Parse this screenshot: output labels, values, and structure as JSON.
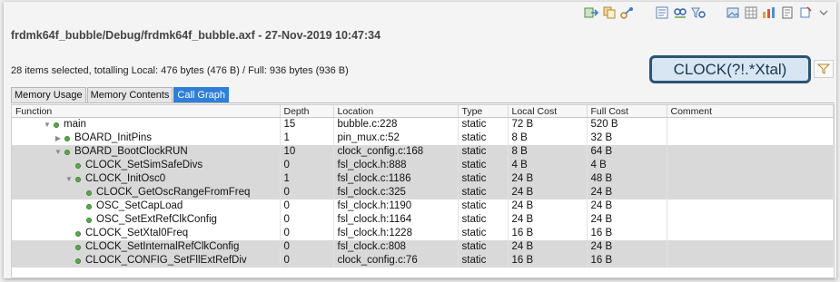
{
  "title": "frdmk64f_bubble/Debug/frdmk64f_bubble.axf - 27-Nov-2019 10:47:34",
  "summary": "28 items selected, totalling Local: 476 bytes (476 B) / Full: 936 bytes (936 B)",
  "filter": {
    "value": "CLOCK(?!.*Xtal)"
  },
  "tabs": [
    {
      "label": "Memory Usage",
      "active": false
    },
    {
      "label": "Memory Contents",
      "active": false
    },
    {
      "label": "Call Graph",
      "active": true
    }
  ],
  "columns": [
    "Function",
    "Depth",
    "Location",
    "Type",
    "Local Cost",
    "Full Cost",
    "Comment"
  ],
  "rows": [
    {
      "indent": 0,
      "twisty": "expanded",
      "name": "main",
      "depth": "15",
      "location": "bubble.c:228",
      "type": "static",
      "local": "72 B",
      "full": "520 B",
      "comment": "",
      "selected": false
    },
    {
      "indent": 1,
      "twisty": "collapsed",
      "name": "BOARD_InitPins",
      "depth": "1",
      "location": "pin_mux.c:52",
      "type": "static",
      "local": "8 B",
      "full": "32 B",
      "comment": "",
      "selected": false
    },
    {
      "indent": 1,
      "twisty": "expanded",
      "name": "BOARD_BootClockRUN",
      "depth": "10",
      "location": "clock_config.c:168",
      "type": "static",
      "local": "8 B",
      "full": "64 B",
      "comment": "",
      "selected": true
    },
    {
      "indent": 2,
      "twisty": "none",
      "name": "CLOCK_SetSimSafeDivs",
      "depth": "0",
      "location": "fsl_clock.h:888",
      "type": "static",
      "local": "4 B",
      "full": "4 B",
      "comment": "",
      "selected": true
    },
    {
      "indent": 2,
      "twisty": "expanded",
      "name": "CLOCK_InitOsc0",
      "depth": "1",
      "location": "fsl_clock.c:1186",
      "type": "static",
      "local": "24 B",
      "full": "48 B",
      "comment": "",
      "selected": true
    },
    {
      "indent": 3,
      "twisty": "none",
      "name": "CLOCK_GetOscRangeFromFreq",
      "depth": "0",
      "location": "fsl_clock.c:325",
      "type": "static",
      "local": "24 B",
      "full": "24 B",
      "comment": "",
      "selected": true
    },
    {
      "indent": 3,
      "twisty": "none",
      "name": "OSC_SetCapLoad",
      "depth": "0",
      "location": "fsl_clock.h:1190",
      "type": "static",
      "local": "24 B",
      "full": "24 B",
      "comment": "",
      "selected": false
    },
    {
      "indent": 3,
      "twisty": "none",
      "name": "OSC_SetExtRefClkConfig",
      "depth": "0",
      "location": "fsl_clock.h:1164",
      "type": "static",
      "local": "24 B",
      "full": "24 B",
      "comment": "",
      "selected": false
    },
    {
      "indent": 2,
      "twisty": "none",
      "name": "CLOCK_SetXtal0Freq",
      "depth": "0",
      "location": "fsl_clock.h:1228",
      "type": "static",
      "local": "16 B",
      "full": "16 B",
      "comment": "",
      "selected": false
    },
    {
      "indent": 2,
      "twisty": "none",
      "name": "CLOCK_SetInternalRefClkConfig",
      "depth": "0",
      "location": "fsl_clock.c:808",
      "type": "static",
      "local": "24 B",
      "full": "24 B",
      "comment": "",
      "selected": true
    },
    {
      "indent": 2,
      "twisty": "none",
      "name": "CLOCK_CONFIG_SetFllExtRefDiv",
      "depth": "0",
      "location": "clock_config.c:76",
      "type": "static",
      "local": "16 B",
      "full": "16 B",
      "comment": "",
      "selected": true
    }
  ],
  "toolbar_icons": [
    "export-icon",
    "copy-icon",
    "link-icon",
    "properties-icon",
    "find-icon",
    "filter-icon",
    "image-icon",
    "grid-icon",
    "chart-icon",
    "document-icon",
    "pin-icon",
    "menu-dropdown-icon"
  ]
}
